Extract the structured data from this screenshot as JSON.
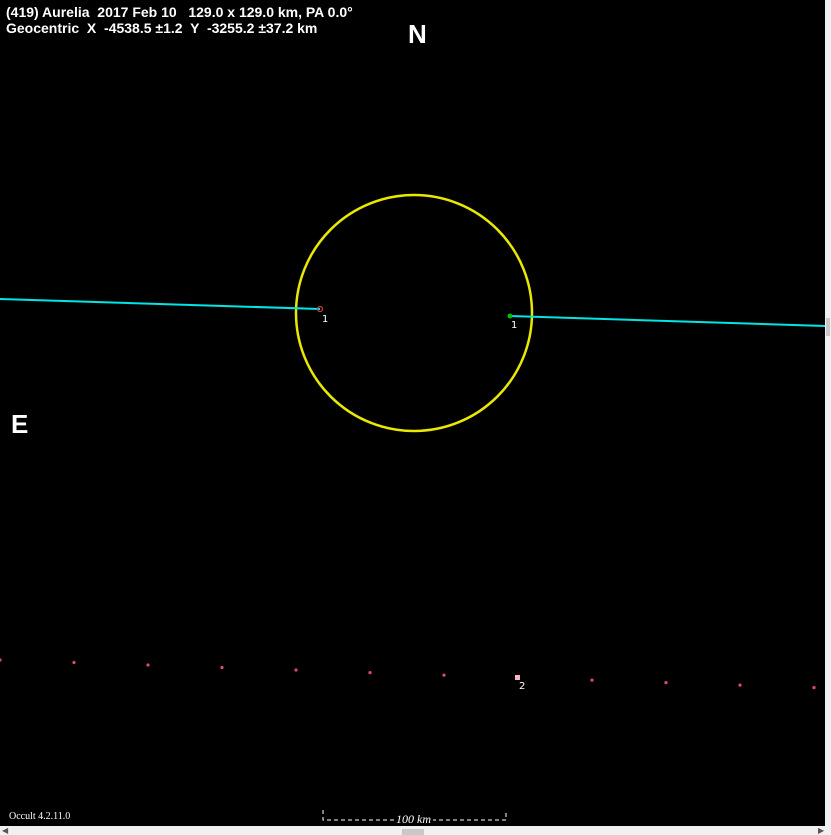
{
  "header": {
    "line1": "(419) Aurelia  2017 Feb 10   129.0 x 129.0 km, PA 0.0°",
    "line2": "Geocentric  X  -4538.5 ±1.2  Y  -3255.2 ±37.2 km"
  },
  "compass": {
    "north": "N",
    "east": "E"
  },
  "footer": {
    "version": "Occult 4.2.11.0",
    "scale_label": "100 km"
  },
  "chords": [
    {
      "label": "1",
      "color": "#00e5e5",
      "disappear_marker_color": "#d04040",
      "reappear_marker_color": "#00c000"
    }
  ],
  "miss_chord": {
    "label": "2",
    "dot_color": "#e04a6a",
    "marker_color": "#ffb0d0"
  },
  "colors": {
    "background": "#000000",
    "outline": "#e8e800",
    "chord": "#00e5e5",
    "text": "#ffffff",
    "window": "#f0f0f0"
  }
}
